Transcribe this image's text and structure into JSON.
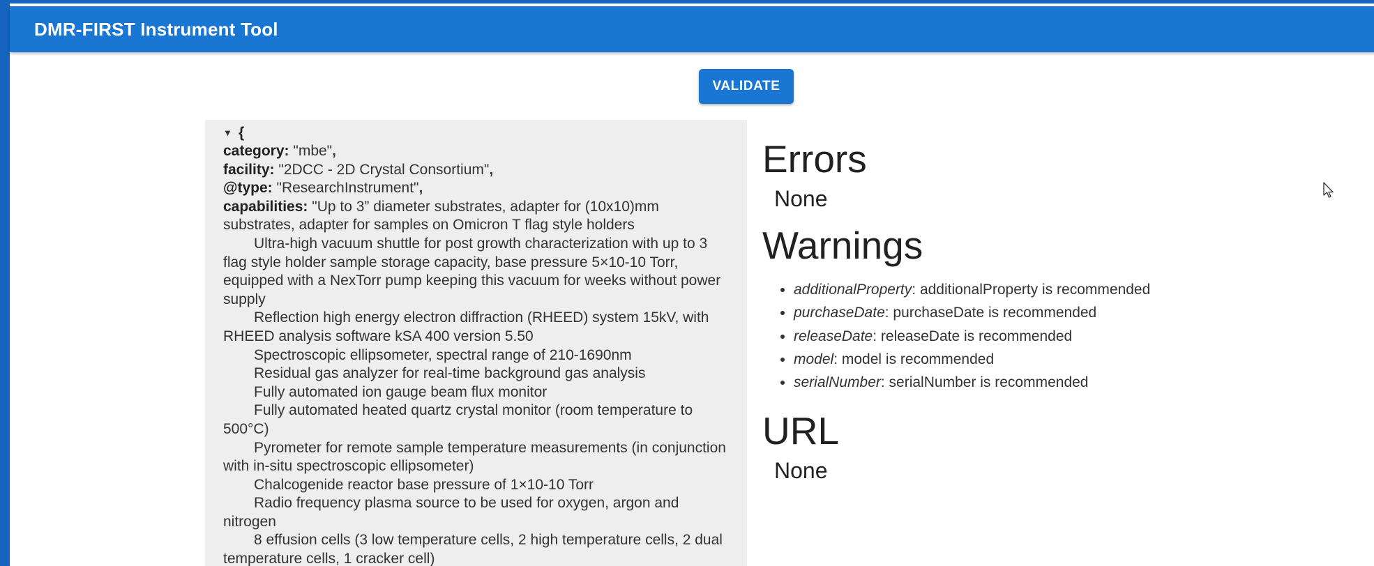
{
  "app": {
    "title": "DMR-FIRST Instrument Tool"
  },
  "toolbar": {
    "validate_label": "VALIDATE"
  },
  "json_view": {
    "open_brace": "{",
    "fields": [
      {
        "key": "category:",
        "value": "\"mbe\"",
        "comma": ","
      },
      {
        "key": "facility:",
        "value": "\"2DCC - 2D Crystal Consortium\"",
        "comma": ","
      },
      {
        "key": "@type:",
        "value": "\"ResearchInstrument\"",
        "comma": ","
      }
    ],
    "capabilities_key": "capabilities:",
    "capabilities_lines": [
      {
        "text": "\"Up to 3” diameter substrates, adapter for (10x10)mm substrates, adapter for samples on Omicron T flag style holders",
        "indent": false
      },
      {
        "text": "Ultra-high vacuum shuttle for post growth characterization with up to 3 flag style holder sample storage capacity, base pressure 5×10-10 Torr, equipped with a NexTorr pump keeping this vacuum for weeks without power supply",
        "indent": true
      },
      {
        "text": "Reflection high energy electron diffraction (RHEED) system 15kV, with RHEED analysis software kSA 400 version 5.50",
        "indent": true
      },
      {
        "text": "Spectroscopic ellipsometer, spectral range of 210-1690nm",
        "indent": true
      },
      {
        "text": "Residual gas analyzer for real-time background gas analysis",
        "indent": true
      },
      {
        "text": "Fully automated ion gauge beam flux monitor",
        "indent": true
      },
      {
        "text": "Fully automated heated quartz crystal monitor (room temperature to 500°C)",
        "indent": true
      },
      {
        "text": "Pyrometer for remote sample temperature measurements (in conjunction with in-situ spectroscopic ellipsometer)",
        "indent": true
      },
      {
        "text": "Chalcogenide reactor base pressure of 1×10-10 Torr",
        "indent": true
      },
      {
        "text": "Radio frequency plasma source to be used for oxygen, argon and nitrogen",
        "indent": true
      },
      {
        "text": "8 effusion cells (3 low temperature cells, 2 high temperature cells, 2 dual temperature cells, 1 cracker cell)",
        "indent": true
      }
    ]
  },
  "results": {
    "errors_heading": "Errors",
    "errors_value": "None",
    "warnings_heading": "Warnings",
    "warnings": [
      {
        "prop": "additionalProperty",
        "message": ": additionalProperty is recommended"
      },
      {
        "prop": "purchaseDate",
        "message": ": purchaseDate is recommended"
      },
      {
        "prop": "releaseDate",
        "message": ": releaseDate is recommended"
      },
      {
        "prop": "model",
        "message": ": model is recommended"
      },
      {
        "prop": "serialNumber",
        "message": ": serialNumber is recommended"
      }
    ],
    "url_heading": "URL",
    "url_value": "None"
  },
  "colors": {
    "appbar": "#1976d2",
    "button": "#1976d2",
    "panel_bg": "#eeeeee"
  }
}
